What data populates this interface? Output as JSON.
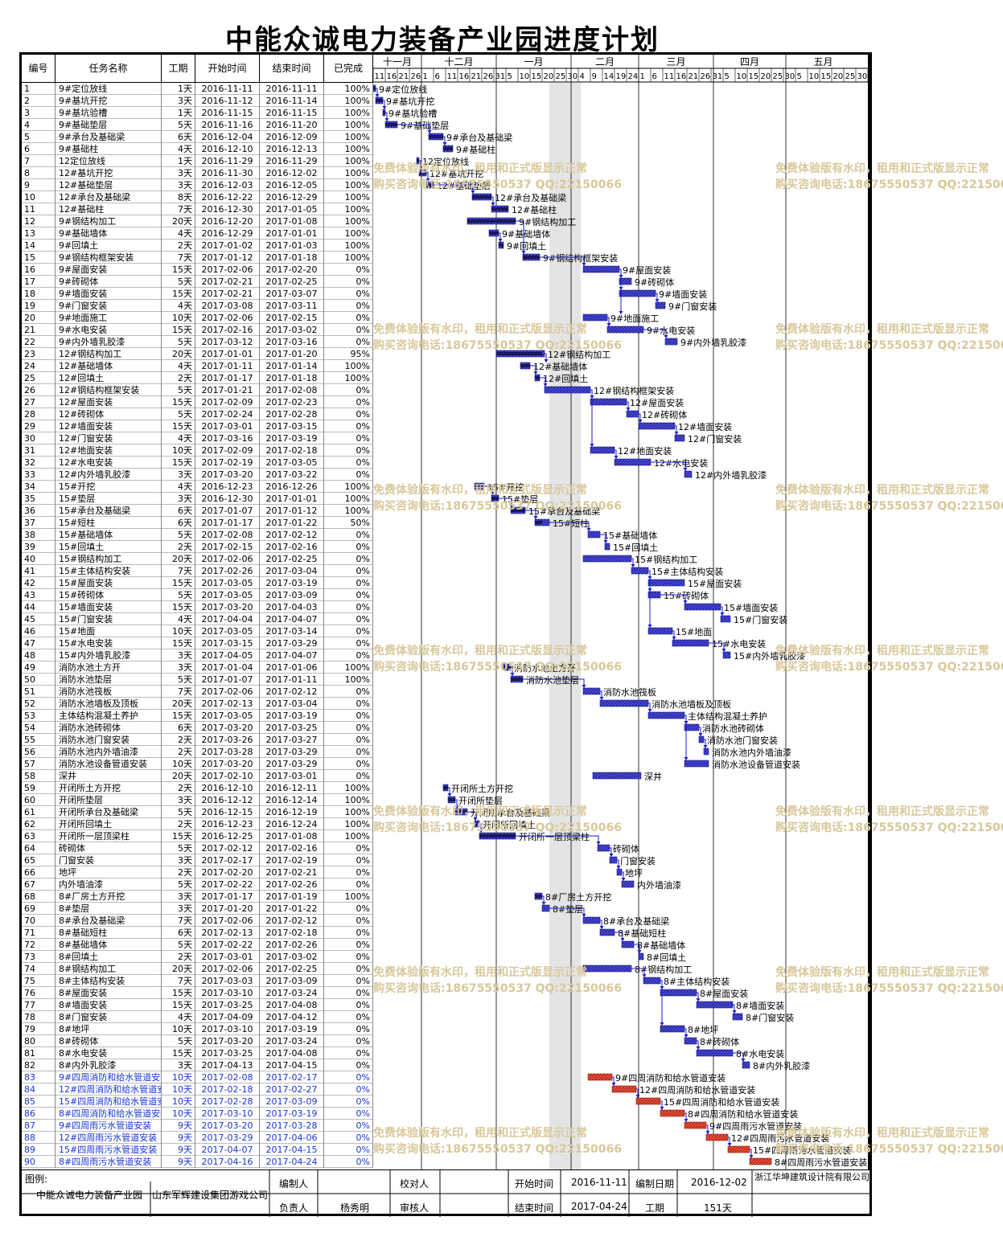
{
  "title": "中能众诚电力装备产业园进度计划",
  "header": {
    "id": "编号",
    "name": "任务名称",
    "duration": "工期",
    "start": "开始时间",
    "end": "结束时间",
    "percent": "已完成"
  },
  "months": [
    "十一月",
    "十二月",
    "一月",
    "二月",
    "三月",
    "四月",
    "五月"
  ],
  "days": [
    "11",
    "16",
    "21",
    "26",
    "1",
    "6",
    "11",
    "16",
    "21",
    "26",
    "31",
    "5",
    "10",
    "15",
    "20",
    "25",
    "30",
    "4",
    "9",
    "14",
    "19",
    "24",
    "1",
    "6",
    "11",
    "16",
    "21",
    "26",
    "31",
    "5",
    "10",
    "15",
    "20",
    "25",
    "30",
    "5",
    "10",
    "15",
    "20",
    "25",
    "30",
    "4"
  ],
  "tasks": [
    [
      "1",
      "9#定位放线",
      "1天",
      "2016-11-11",
      "2016-11-11",
      "100%"
    ],
    [
      "2",
      "9#基坑开挖",
      "3天",
      "2016-11-12",
      "2016-11-14",
      "100%"
    ],
    [
      "3",
      "9#基坑验槽",
      "1天",
      "2016-11-15",
      "2016-11-15",
      "100%"
    ],
    [
      "4",
      "9#基础垫层",
      "5天",
      "2016-11-16",
      "2016-11-20",
      "100%"
    ],
    [
      "5",
      "9#承台及基础梁",
      "6天",
      "2016-12-04",
      "2016-12-09",
      "100%"
    ],
    [
      "6",
      "9#基础柱",
      "4天",
      "2016-12-10",
      "2016-12-13",
      "100%"
    ],
    [
      "7",
      "12定位放线",
      "1天",
      "2016-11-29",
      "2016-11-29",
      "100%"
    ],
    [
      "8",
      "12#基坑开挖",
      "3天",
      "2016-11-30",
      "2016-12-02",
      "100%"
    ],
    [
      "9",
      "12#基础垫层",
      "3天",
      "2016-12-03",
      "2016-12-05",
      "100%"
    ],
    [
      "10",
      "12#承台及基础梁",
      "8天",
      "2016-12-22",
      "2016-12-29",
      "100%"
    ],
    [
      "11",
      "12#基础柱",
      "7天",
      "2016-12-30",
      "2017-01-05",
      "100%"
    ],
    [
      "12",
      "9#钢结构加工",
      "20天",
      "2016-12-20",
      "2017-01-08",
      "100%"
    ],
    [
      "13",
      "9#基础墙体",
      "4天",
      "2016-12-29",
      "2017-01-01",
      "100%"
    ],
    [
      "14",
      "9#回填土",
      "2天",
      "2017-01-02",
      "2017-01-03",
      "100%"
    ],
    [
      "15",
      "9#钢结构框架安装",
      "7天",
      "2017-01-12",
      "2017-01-18",
      "100%"
    ],
    [
      "16",
      "9#屋面安装",
      "15天",
      "2017-02-06",
      "2017-02-20",
      "0%"
    ],
    [
      "17",
      "9#砖砌体",
      "5天",
      "2017-02-21",
      "2017-02-25",
      "0%"
    ],
    [
      "18",
      "9#墙面安装",
      "15天",
      "2017-02-21",
      "2017-03-07",
      "0%"
    ],
    [
      "19",
      "9#门窗安装",
      "4天",
      "2017-03-08",
      "2017-03-11",
      "0%"
    ],
    [
      "20",
      "9#地面施工",
      "10天",
      "2017-02-06",
      "2017-02-15",
      "0%"
    ],
    [
      "21",
      "9#水电安装",
      "15天",
      "2017-02-16",
      "2017-03-02",
      "0%"
    ],
    [
      "22",
      "9#内外墙乳胶漆",
      "5天",
      "2017-03-12",
      "2017-03-16",
      "0%"
    ],
    [
      "23",
      "12#钢结构加工",
      "20天",
      "2017-01-01",
      "2017-01-20",
      "95%"
    ],
    [
      "24",
      "12#基础墙体",
      "4天",
      "2017-01-11",
      "2017-01-14",
      "100%"
    ],
    [
      "25",
      "12#回填土",
      "2天",
      "2017-01-17",
      "2017-01-18",
      "100%"
    ],
    [
      "26",
      "12#钢结构框架安装",
      "5天",
      "2017-01-21",
      "2017-02-08",
      "0%"
    ],
    [
      "27",
      "12#屋面安装",
      "15天",
      "2017-02-09",
      "2017-02-23",
      "0%"
    ],
    [
      "28",
      "12#砖砌体",
      "5天",
      "2017-02-24",
      "2017-02-28",
      "0%"
    ],
    [
      "29",
      "12#墙面安装",
      "15天",
      "2017-03-01",
      "2017-03-15",
      "0%"
    ],
    [
      "30",
      "12#门窗安装",
      "4天",
      "2017-03-16",
      "2017-03-19",
      "0%"
    ],
    [
      "31",
      "12#地面安装",
      "10天",
      "2017-02-09",
      "2017-02-18",
      "0%"
    ],
    [
      "32",
      "12#水电安装",
      "15天",
      "2017-02-19",
      "2017-03-05",
      "0%"
    ],
    [
      "33",
      "12#内外墙乳胶漆",
      "3天",
      "2017-03-20",
      "2017-03-22",
      "0%"
    ],
    [
      "34",
      "15#开挖",
      "4天",
      "2016-12-23",
      "2016-12-26",
      "100%"
    ],
    [
      "35",
      "15#垫层",
      "3天",
      "2016-12-30",
      "2017-01-01",
      "100%"
    ],
    [
      "36",
      "15#承台及基础梁",
      "6天",
      "2017-01-07",
      "2017-01-12",
      "100%"
    ],
    [
      "37",
      "15#短柱",
      "6天",
      "2017-01-17",
      "2017-01-22",
      "50%"
    ],
    [
      "38",
      "15#基础墙体",
      "5天",
      "2017-02-08",
      "2017-02-12",
      "0%"
    ],
    [
      "39",
      "15#回填土",
      "2天",
      "2017-02-15",
      "2017-02-16",
      "0%"
    ],
    [
      "40",
      "15#钢结构加工",
      "20天",
      "2017-02-06",
      "2017-02-25",
      "0%"
    ],
    [
      "41",
      "15#主体结构安装",
      "7天",
      "2017-02-26",
      "2017-03-04",
      "0%"
    ],
    [
      "42",
      "15#屋面安装",
      "15天",
      "2017-03-05",
      "2017-03-19",
      "0%"
    ],
    [
      "43",
      "15#砖砌体",
      "5天",
      "2017-03-05",
      "2017-03-09",
      "0%"
    ],
    [
      "44",
      "15#墙面安装",
      "15天",
      "2017-03-20",
      "2017-04-03",
      "0%"
    ],
    [
      "45",
      "15#门窗安装",
      "4天",
      "2017-04-04",
      "2017-04-07",
      "0%"
    ],
    [
      "46",
      "15#地面",
      "10天",
      "2017-03-05",
      "2017-03-14",
      "0%"
    ],
    [
      "47",
      "15#水电安装",
      "15天",
      "2017-03-15",
      "2017-03-29",
      "0%"
    ],
    [
      "48",
      "15#内外墙乳胶漆",
      "3天",
      "2017-04-05",
      "2017-04-07",
      "0%"
    ],
    [
      "49",
      "消防水池土方开",
      "3天",
      "2017-01-04",
      "2017-01-06",
      "100%"
    ],
    [
      "50",
      "消防水池垫层",
      "5天",
      "2017-01-07",
      "2017-01-11",
      "100%"
    ],
    [
      "51",
      "消防水池筏板",
      "7天",
      "2017-02-06",
      "2017-02-12",
      "0%"
    ],
    [
      "52",
      "消防水池墙板及顶板",
      "20天",
      "2017-02-13",
      "2017-03-04",
      "0%"
    ],
    [
      "53",
      "主体结构混凝土养护",
      "15天",
      "2017-03-05",
      "2017-03-19",
      "0%"
    ],
    [
      "54",
      "消防水池砖砌体",
      "6天",
      "2017-03-20",
      "2017-03-25",
      "0%"
    ],
    [
      "55",
      "消防水池门窗安装",
      "2天",
      "2017-03-26",
      "2017-03-27",
      "0%"
    ],
    [
      "56",
      "消防水池内外墙油漆",
      "2天",
      "2017-03-28",
      "2017-03-29",
      "0%"
    ],
    [
      "57",
      "消防水池设备管道安装",
      "10天",
      "2017-03-20",
      "2017-03-29",
      "0%"
    ],
    [
      "58",
      "深井",
      "20天",
      "2017-02-10",
      "2017-03-01",
      "0%"
    ],
    [
      "59",
      "开闭所土方开挖",
      "2天",
      "2016-12-10",
      "2016-12-11",
      "100%"
    ],
    [
      "60",
      "开闭所垫层",
      "3天",
      "2016-12-12",
      "2016-12-14",
      "100%"
    ],
    [
      "61",
      "开闭所承台及基础梁",
      "5天",
      "2016-12-15",
      "2016-12-19",
      "100%"
    ],
    [
      "62",
      "开闭所回填土",
      "2天",
      "2016-12-23",
      "2016-12-24",
      "100%"
    ],
    [
      "63",
      "开闭所一层顶梁柱",
      "15天",
      "2016-12-25",
      "2017-01-08",
      "100%"
    ],
    [
      "64",
      "砖砌体",
      "5天",
      "2017-02-12",
      "2017-02-16",
      "0%"
    ],
    [
      "65",
      "门窗安装",
      "3天",
      "2017-02-17",
      "2017-02-19",
      "0%"
    ],
    [
      "66",
      "地坪",
      "2天",
      "2017-02-20",
      "2017-02-21",
      "0%"
    ],
    [
      "67",
      "内外墙油漆",
      "5天",
      "2017-02-22",
      "2017-02-26",
      "0%"
    ],
    [
      "68",
      "8#厂房土方开挖",
      "3天",
      "2017-01-17",
      "2017-01-19",
      "100%"
    ],
    [
      "69",
      "8#垫层",
      "3天",
      "2017-01-20",
      "2017-01-22",
      "0%"
    ],
    [
      "70",
      "8#承台及基础梁",
      "7天",
      "2017-02-06",
      "2017-02-12",
      "0%"
    ],
    [
      "71",
      "8#基础短柱",
      "6天",
      "2017-02-13",
      "2017-02-18",
      "0%"
    ],
    [
      "72",
      "8#基础墙体",
      "5天",
      "2017-02-22",
      "2017-02-26",
      "0%"
    ],
    [
      "73",
      "8#回填土",
      "2天",
      "2017-03-01",
      "2017-03-02",
      "0%"
    ],
    [
      "74",
      "8#钢结构加工",
      "20天",
      "2017-02-06",
      "2017-02-25",
      "0%"
    ],
    [
      "75",
      "8#主体结构安装",
      "7天",
      "2017-03-03",
      "2017-03-09",
      "0%"
    ],
    [
      "76",
      "8#屋面安装",
      "15天",
      "2017-03-10",
      "2017-03-24",
      "0%"
    ],
    [
      "77",
      "8#墙面安装",
      "15天",
      "2017-03-25",
      "2017-04-08",
      "0%"
    ],
    [
      "78",
      "8#门窗安装",
      "4天",
      "2017-04-09",
      "2017-04-12",
      "0%"
    ],
    [
      "79",
      "8#地坪",
      "10天",
      "2017-03-10",
      "2017-03-19",
      "0%"
    ],
    [
      "80",
      "8#砖砌体",
      "5天",
      "2017-03-20",
      "2017-03-24",
      "0%"
    ],
    [
      "81",
      "8#水电安装",
      "15天",
      "2017-03-25",
      "2017-04-08",
      "0%"
    ],
    [
      "82",
      "8#内外乳胶漆",
      "3天",
      "2017-04-13",
      "2017-04-15",
      "0%"
    ],
    [
      "83",
      "9#四周消防和给水管道安装",
      "10天",
      "2017-02-08",
      "2017-02-17",
      "0%"
    ],
    [
      "84",
      "12#四周消防和给水管道安装",
      "10天",
      "2017-02-18",
      "2017-02-27",
      "0%"
    ],
    [
      "85",
      "15#四周消防和给水管道安装",
      "10天",
      "2017-02-28",
      "2017-03-09",
      "0%"
    ],
    [
      "86",
      "8#四周消防和给水管道安装",
      "10天",
      "2017-03-10",
      "2017-03-19",
      "0%"
    ],
    [
      "87",
      "9#四周雨污水管道安装",
      "9天",
      "2017-03-20",
      "2017-03-28",
      "0%"
    ],
    [
      "88",
      "12#四周雨污水管道安装",
      "9天",
      "2017-03-29",
      "2017-04-06",
      "0%"
    ],
    [
      "89",
      "15#四周雨污水管道安装",
      "9天",
      "2017-04-07",
      "2017-04-15",
      "0%"
    ],
    [
      "90",
      "8#四周雨污水管道安装",
      "9天",
      "2017-04-16",
      "2017-04-24",
      "0%"
    ]
  ],
  "footer": {
    "legend": "图例:",
    "project": "中能众诚电力装备产业园",
    "contractor": "山东军辉建设集团游戏公司",
    "compiler_label": "编制人",
    "compiler": "",
    "checker_label": "校对人",
    "checker": "",
    "manager_label": "负责人",
    "manager": "杨秀明",
    "reviewer_label": "审核人",
    "reviewer": "",
    "start_label": "开始时间",
    "start": "2016-11-11",
    "end_label": "结束时间",
    "end": "2017-04-24",
    "date_label": "编制日期",
    "date": "2016-12-02",
    "duration_label": "工期",
    "duration": "151天",
    "company": "浙江华坤建筑设计院有限公司"
  },
  "watermark": {
    "line1": "免费体验版有水印，租用和正式版显示正常",
    "line2": "购买咨询电话:18675550537 QQ:22150066"
  },
  "colors": {
    "bar": "#3f3fd0",
    "bar_done_hatch": "#000080",
    "bar_red": "#e03020",
    "link": "#0000cc"
  }
}
